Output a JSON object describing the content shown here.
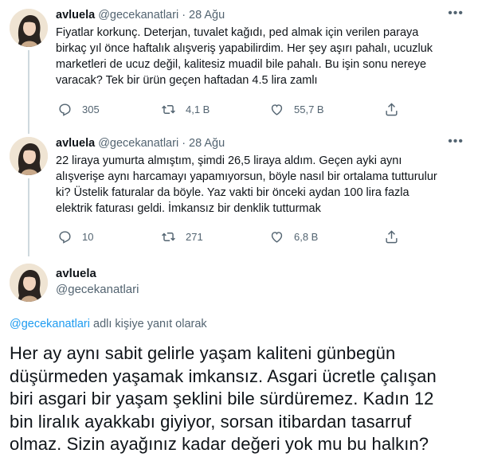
{
  "tweets": [
    {
      "name": "avluela",
      "handle": "@gecekanatlari",
      "dot": "·",
      "date": "28 Ağu",
      "more_icon": "more-icon",
      "text": "Fiyatlar korkunç. Deterjan, tuvalet kağıdı, ped almak için verilen paraya\nbirkaç yıl önce haftalık alışveriş yapabilirdim. Her şey aşırı pahalı, ucuzluk\nmarketleri de ucuz değil, kalitesiz muadil bile pahalı. Bu işin sonu nereye\nvaracak? Tek bir ürün geçen haftadan 4.5 lira zamlı",
      "replies": "305",
      "retweets": "4,1 B",
      "likes": "55,7 B"
    },
    {
      "name": "avluela",
      "handle": "@gecekanatlari",
      "dot": "·",
      "date": "28 Ağu",
      "more_icon": "more-icon",
      "text": "22 liraya yumurta almıştım, şimdi 26,5 liraya aldım. Geçen ayki aynı\nalışverişe aynı harcamayı yapamıyorsun, böyle nasıl bir ortalama tutturulur\nki? Üstelik faturalar da böyle. Yaz vakti bir önceki aydan 100 lira fazla\nelektrik faturası geldi. İmkansız bir denklik tutturmak",
      "replies": "10",
      "retweets": "271",
      "likes": "6,8 B"
    }
  ],
  "main_tweet": {
    "name": "avluela",
    "handle": "@gecekanatlari",
    "reply_mention": "@gecekanatlari",
    "reply_suffix": " adlı kişiye yanıt olarak",
    "text": "Her ay aynı sabit gelirle yaşam kaliteni günbegün\ndüşürmeden yaşamak imkansız. Asgari ücretle çalışan\nbiri asgari bir yaşam şeklini bile sürdüremez. Kadın 12\nbin liralık ayakkabı giyiyor, sorsan itibardan tasarruf\nolmaz. Sizin ayağınız kadar değeri yok mu bu halkın?"
  },
  "icons": {
    "reply": "reply-icon",
    "retweet": "retweet-icon",
    "like": "heart-icon",
    "share": "share-icon",
    "avatar": "avatar"
  },
  "colors": {
    "text": "#0f1419",
    "secondary": "#536471",
    "link": "#1d9bf0",
    "thread_line": "#cfd9de"
  }
}
